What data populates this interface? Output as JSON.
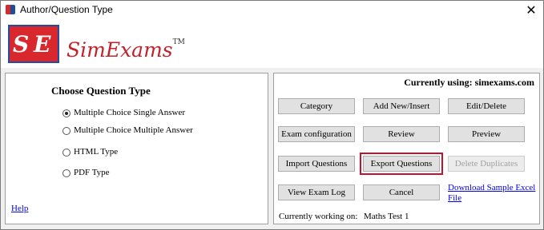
{
  "window": {
    "title": "Author/Question Type",
    "close_glyph": "✕"
  },
  "logo": {
    "letter_s": "S",
    "letter_e": "E",
    "name": "SimExams",
    "tm": "TM"
  },
  "left": {
    "title": "Choose Question Type",
    "options": [
      {
        "label": "Multiple Choice Single Answer",
        "checked": true
      },
      {
        "label": "Multiple Choice Multiple Answer",
        "checked": false
      },
      {
        "label": "HTML Type",
        "checked": false
      },
      {
        "label": "PDF Type",
        "checked": false
      }
    ],
    "help": "Help"
  },
  "right": {
    "currently_using": "Currently using: simexams.com",
    "buttons": {
      "category": "Category",
      "add_new": "Add New/Insert",
      "edit_delete": "Edit/Delete",
      "exam_config": "Exam configuration",
      "review": "Review",
      "preview": "Preview",
      "import": "Import Questions",
      "export": "Export Questions",
      "delete_duplicates": "Delete Duplicates",
      "view_log": "View Exam Log",
      "cancel": "Cancel"
    },
    "download_link": "Download Sample Excel File",
    "working_label": "Currently working on:",
    "working_value": "Maths Test 1"
  },
  "colors": {
    "link": "#0000ee",
    "highlight": "#c8102e",
    "logo_red": "#d9272e",
    "logo_blue": "#1f4ea3"
  }
}
